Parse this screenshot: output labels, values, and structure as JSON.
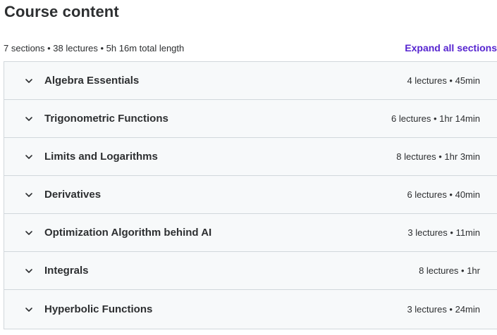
{
  "header": {
    "title": "Course content"
  },
  "summary": {
    "text": "7 sections • 38 lectures • 5h 16m total length",
    "expand_all_label": "Expand all sections"
  },
  "sections": [
    {
      "title": "Algebra Essentials",
      "meta": "4 lectures • 45min",
      "icon": "chevron-down-icon"
    },
    {
      "title": "Trigonometric Functions",
      "meta": "6 lectures • 1hr 14min",
      "icon": "chevron-down-icon"
    },
    {
      "title": "Limits and Logarithms",
      "meta": "8 lectures • 1hr 3min",
      "icon": "chevron-down-icon"
    },
    {
      "title": "Derivatives",
      "meta": "6 lectures • 40min",
      "icon": "chevron-down-icon"
    },
    {
      "title": "Optimization Algorithm behind AI",
      "meta": "3 lectures • 11min",
      "icon": "chevron-down-icon"
    },
    {
      "title": "Integrals",
      "meta": "8 lectures • 1hr",
      "icon": "chevron-down-icon"
    },
    {
      "title": "Hyperbolic Functions",
      "meta": "3 lectures • 24min",
      "icon": "chevron-down-icon"
    }
  ],
  "colors": {
    "link": "#5624d0",
    "text": "#2d2f31",
    "row_bg": "#f7f9fa",
    "border": "#d1d7dc"
  }
}
